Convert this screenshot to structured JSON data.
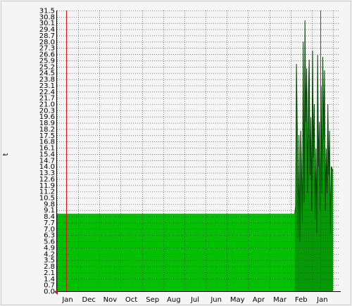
{
  "chart_data": {
    "type": "area",
    "ylabel": "t",
    "yticks": [
      "0.0",
      "0.7",
      "1.4",
      "2.1",
      "2.8",
      "3.5",
      "4.2",
      "4.9",
      "5.6",
      "6.3",
      "7.0",
      "7.7",
      "8.4",
      "9.1",
      "9.8",
      "10.5",
      "11.2",
      "11.9",
      "12.6",
      "13.3",
      "14.0",
      "14.7",
      "15.4",
      "16.1",
      "16.8",
      "17.5",
      "18.2",
      "18.9",
      "19.6",
      "20.3",
      "21.0",
      "21.7",
      "22.4",
      "23.1",
      "23.8",
      "24.5",
      "25.2",
      "25.9",
      "26.6",
      "27.3",
      "28.0",
      "28.7",
      "29.4",
      "30.1",
      "30.8",
      "31.5"
    ],
    "ylim": [
      0,
      31.5
    ],
    "xlim": [
      0,
      13.3
    ],
    "months": [
      "Jan",
      "Dec",
      "Nov",
      "Oct",
      "Sep",
      "Aug",
      "Jul",
      "Jun",
      "May",
      "Apr",
      "Mar",
      "Feb",
      "Jan"
    ],
    "grid": true,
    "marker_lines_x": [
      12.4,
      0.42
    ],
    "series": [
      {
        "values": [
          [
            0.0,
            8.7
          ],
          [
            11.2,
            8.7
          ],
          [
            11.24,
            9.5
          ],
          [
            11.28,
            25.5
          ],
          [
            11.32,
            18.0
          ],
          [
            11.36,
            6.0
          ],
          [
            11.4,
            17.5
          ],
          [
            11.44,
            5.5
          ],
          [
            11.48,
            18.0
          ],
          [
            11.52,
            14.0
          ],
          [
            11.56,
            7.5
          ],
          [
            11.6,
            28.0
          ],
          [
            11.64,
            10.0
          ],
          [
            11.68,
            30.4
          ],
          [
            11.72,
            19.0
          ],
          [
            11.76,
            25.0
          ],
          [
            11.8,
            11.0
          ],
          [
            11.84,
            22.0
          ],
          [
            11.88,
            26.0
          ],
          [
            11.92,
            13.0
          ],
          [
            11.96,
            19.5
          ],
          [
            12.0,
            9.0
          ],
          [
            12.04,
            27.0
          ],
          [
            12.08,
            15.0
          ],
          [
            12.12,
            21.0
          ],
          [
            12.16,
            8.0
          ],
          [
            12.2,
            16.0
          ],
          [
            12.24,
            6.5
          ],
          [
            12.28,
            26.5
          ],
          [
            12.32,
            14.0
          ],
          [
            12.36,
            19.0
          ],
          [
            12.4,
            9.0
          ],
          [
            12.44,
            23.0
          ],
          [
            12.48,
            11.0
          ],
          [
            12.52,
            26.3
          ],
          [
            12.56,
            17.0
          ],
          [
            12.6,
            24.8
          ],
          [
            12.64,
            9.0
          ],
          [
            12.68,
            16.0
          ],
          [
            12.72,
            11.0
          ],
          [
            12.76,
            21.0
          ],
          [
            12.8,
            13.0
          ],
          [
            12.84,
            18.0
          ],
          [
            12.88,
            6.5
          ],
          [
            12.92,
            14.0
          ],
          [
            13.0,
            13.5
          ]
        ]
      }
    ],
    "colors": {
      "fill": "#00c000",
      "spike_fill": "#0a7a0a",
      "spike_line": "#004400",
      "grid": "#000000",
      "marker": "#dd1111",
      "plot_bg": "#f5f5f5"
    }
  }
}
